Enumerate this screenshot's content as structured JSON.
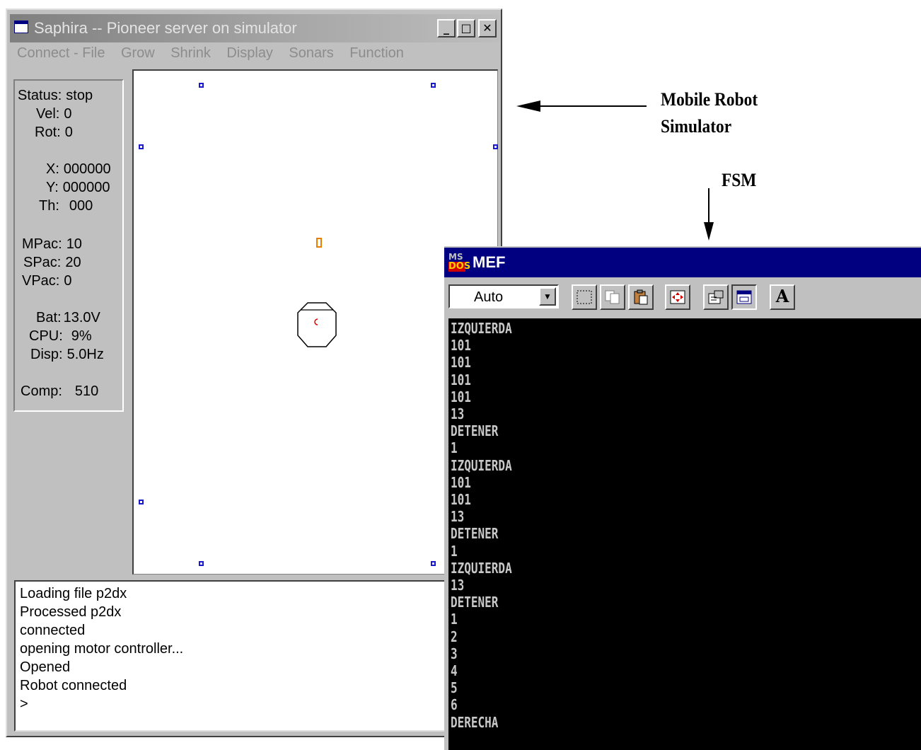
{
  "saphira": {
    "title": "Saphira -- Pioneer server on simulator",
    "window_buttons": [
      "_",
      "□",
      "✕"
    ],
    "menu": [
      "Connect - File",
      "Grow",
      "Shrink",
      "Display",
      "Sonars",
      "Function"
    ],
    "status": {
      "status_label": "Status:",
      "status_value": "stop",
      "vel_label": "Vel:",
      "vel_value": "0",
      "rot_label": "Rot:",
      "rot_value": "0",
      "x_label": "X:",
      "x_value": "000000",
      "y_label": "Y:",
      "y_value": "000000",
      "th_label": "Th:",
      "th_value": "000",
      "mpac_label": "MPac:",
      "mpac_value": "10",
      "spac_label": "SPac:",
      "spac_value": "20",
      "vpac_label": "VPac:",
      "vpac_value": "0",
      "bat_label": "Bat:",
      "bat_value": "13.0V",
      "cpu_label": "CPU:",
      "cpu_value": "9%",
      "disp_label": "Disp:",
      "disp_value": "5.0Hz",
      "comp_label": "Comp:",
      "comp_value": "510"
    },
    "log": [
      "Loading file p2dx",
      "Processed p2dx",
      "connected",
      "opening motor controller...",
      "Opened",
      "Robot connected",
      ">"
    ],
    "colors": {
      "sonar": "#1a1acc",
      "target": "#e87f00",
      "robot_heading": "#dd0000"
    }
  },
  "mef": {
    "icon_top": "MS",
    "icon_bottom": "DOS",
    "title": "MEF",
    "font_select_value": "Auto",
    "toolbar_icons": [
      "mark-icon",
      "copy-icon",
      "paste-icon",
      "fullscreen-icon",
      "properties-icon",
      "background-icon",
      "font-icon"
    ],
    "font_button_label": "A",
    "console_lines": [
      "IZQUIERDA",
      "101",
      "101",
      "101",
      "101",
      "13",
      "DETENER",
      "1",
      "IZQUIERDA",
      "101",
      "101",
      "13",
      "DETENER",
      "1",
      "IZQUIERDA",
      "13",
      "DETENER",
      "1",
      "2",
      "3",
      "4",
      "5",
      "6",
      "DERECHA"
    ],
    "title_color": "#000080"
  },
  "annotations": {
    "simulator_line1": "Mobile Robot",
    "simulator_line2": "Simulator",
    "fsm": "FSM"
  }
}
